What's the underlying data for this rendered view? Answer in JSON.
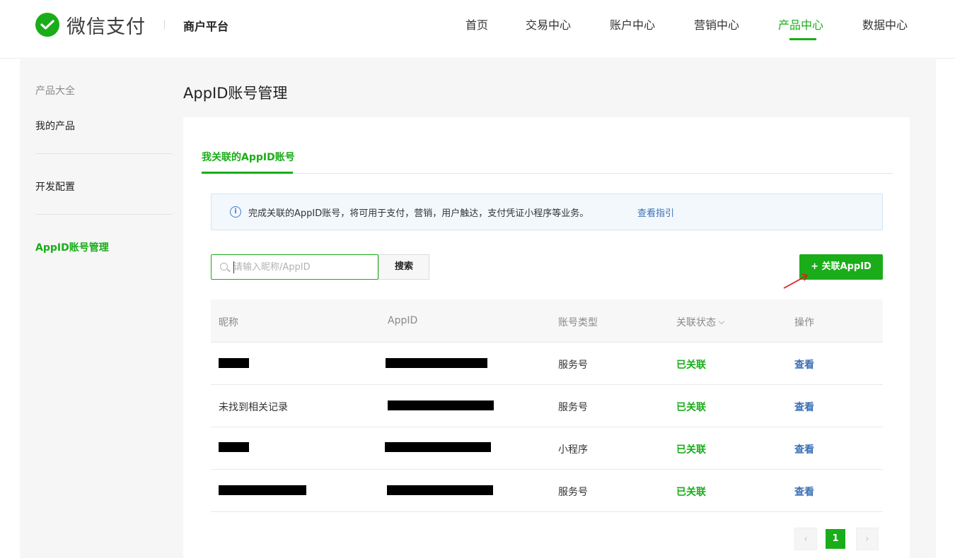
{
  "header": {
    "logo_text": "微信支付",
    "platform": "商户平台",
    "nav": [
      {
        "label": "首页"
      },
      {
        "label": "交易中心"
      },
      {
        "label": "账户中心"
      },
      {
        "label": "营销中心"
      },
      {
        "label": "产品中心",
        "active": true
      },
      {
        "label": "数据中心"
      }
    ]
  },
  "sidebar": {
    "group_label": "产品大全",
    "items": [
      {
        "label": "我的产品"
      },
      {
        "label": "开发配置"
      },
      {
        "label": "AppID账号管理",
        "active": true
      }
    ]
  },
  "main": {
    "title": "AppID账号管理",
    "tab": "我关联的AppID账号",
    "notice": {
      "icon": "info-icon",
      "text": "完成关联的AppID账号，将可用于支付，营销，用户触达，支付凭证小程序等业务。",
      "link": "查看指引"
    },
    "search": {
      "placeholder": "请输入昵称/AppID",
      "value": "",
      "button": "搜索"
    },
    "add_button": "+ 关联AppID",
    "table": {
      "columns": [
        "昵称",
        "AppID",
        "账号类型",
        "关联状态",
        "操作"
      ],
      "rows": [
        {
          "nickname": "",
          "appid": "",
          "type": "服务号",
          "status": "已关联",
          "action": "查看"
        },
        {
          "nickname": "未找到相关记录",
          "appid": "",
          "type": "服务号",
          "status": "已关联",
          "action": "查看"
        },
        {
          "nickname": "",
          "appid": "",
          "type": "小程序",
          "status": "已关联",
          "action": "查看"
        },
        {
          "nickname": "",
          "appid": "",
          "type": "服务号",
          "status": "已关联",
          "action": "查看"
        }
      ]
    },
    "pagination": {
      "current": "1",
      "prev_icon": "chevron-left-icon",
      "next_icon": "chevron-right-icon"
    }
  },
  "colors": {
    "accent": "#1aad19",
    "link": "#3b6fb6",
    "annotation_arrow": "#e02020"
  }
}
